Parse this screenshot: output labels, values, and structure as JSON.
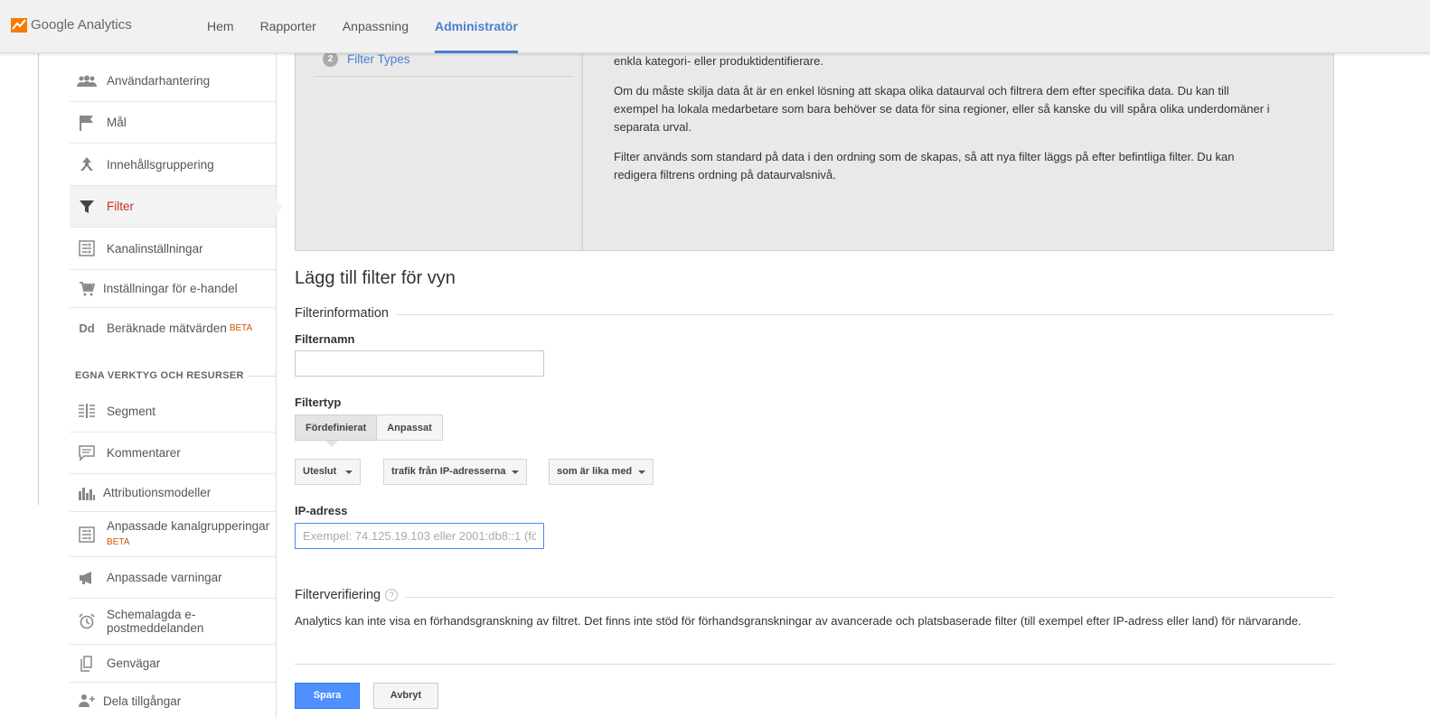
{
  "app": {
    "name": "Google Analytics"
  },
  "nav": [
    {
      "label": "Hem"
    },
    {
      "label": "Rapporter"
    },
    {
      "label": "Anpassning"
    },
    {
      "label": "Administratör",
      "active": true
    }
  ],
  "sidebar": {
    "items": [
      {
        "label": "Användarhantering",
        "icon": "users-icon"
      },
      {
        "label": "Mål",
        "icon": "flag-icon"
      },
      {
        "label": "Innehållsgruppering",
        "icon": "content-grouping-icon"
      },
      {
        "label": "Filter",
        "icon": "filter-icon",
        "active": true
      },
      {
        "label": "Kanalinställningar",
        "icon": "channel-settings-icon"
      },
      {
        "label": "Inställningar för e-handel",
        "icon": "cart-icon"
      },
      {
        "label": "Beräknade mätvärden",
        "icon": "calculated-metrics-icon",
        "badge": "BETA"
      }
    ],
    "section_title": "EGNA VERKTYG OCH RESURSER",
    "tools": [
      {
        "label": "Segment",
        "icon": "segment-icon"
      },
      {
        "label": "Kommentarer",
        "icon": "comment-icon"
      },
      {
        "label": "Attributionsmodeller",
        "icon": "bar-chart-icon"
      },
      {
        "label": "Anpassade kanalgrupperingar",
        "icon": "channel-grouping-icon",
        "badge": "BETA"
      },
      {
        "label": "Anpassade varningar",
        "icon": "megaphone-icon"
      },
      {
        "label": "Schemalagda e-postmeddelanden",
        "label_line1": "Schemalagda e-",
        "label_line2": "postmeddelanden",
        "icon": "alarm-clock-icon"
      },
      {
        "label": "Genvägar",
        "icon": "shortcut-icon"
      },
      {
        "label": "Dela tillgångar",
        "icon": "share-user-icon"
      }
    ]
  },
  "panel": {
    "step_number": "2",
    "step_label": "Filter Types",
    "paragraphs": [
      "enkla kategori- eller produktidentifierare.",
      "Om du måste skilja data åt är en enkel lösning att skapa olika dataurval och filtrera dem efter specifika data. Du kan till exempel ha lokala medarbetare som bara behöver se data för sina regioner, eller så kanske du vill spåra olika underdomäner i separata urval.",
      "Filter används som standard på data i den ordning som de skapas, så att nya filter läggs på efter befintliga filter. Du kan redigera filtrens ordning på dataurvalsnivå."
    ]
  },
  "form": {
    "heading": "Lägg till filter för vyn",
    "info_section": "Filterinformation",
    "name_label": "Filternamn",
    "name_value": "",
    "type_label": "Filtertyp",
    "type_options": [
      "Fördefinierat",
      "Anpassat"
    ],
    "type_selected": "Fördefinierat",
    "dropdown_action": "Uteslut",
    "dropdown_source": "trafik från IP-adresserna",
    "dropdown_expression": "som är lika med",
    "ip_label": "IP-adress",
    "ip_placeholder": "Exempel: 74.125.19.103 eller 2001:db8::1 (fö",
    "ip_value": "",
    "verify_section": "Filterverifiering",
    "verify_help": "?",
    "verify_text": "Analytics kan inte visa en förhandsgranskning av filtret. Det finns inte stöd för förhandsgranskningar av avancerade och platsbaserade filter (till exempel efter IP-adress eller land) för närvarande.",
    "save_label": "Spara",
    "cancel_label": "Avbryt"
  },
  "colors": {
    "accent": "#4a7fd0",
    "active_item": "#c9302c",
    "primary_button": "#4d90fe",
    "beta": "#d35400",
    "logo_orange": "#f57c00"
  }
}
